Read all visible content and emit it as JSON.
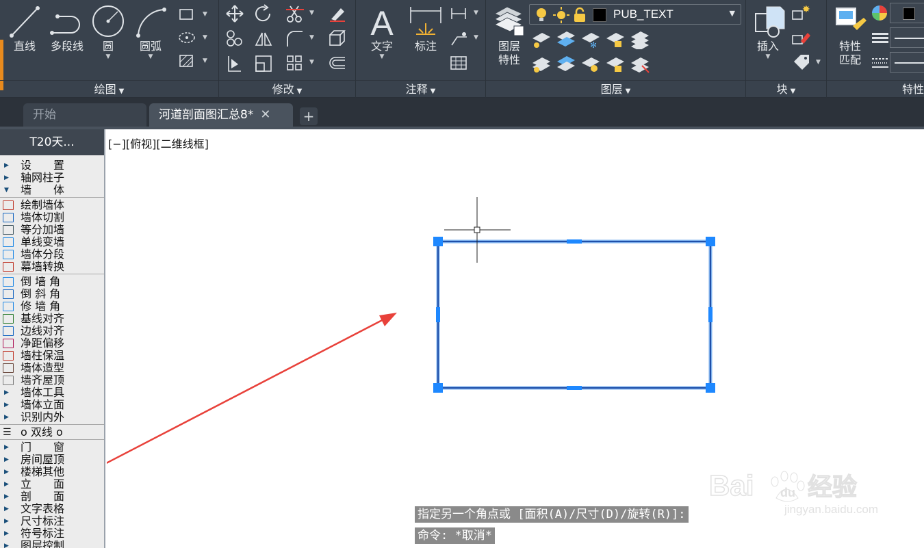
{
  "ribbon": {
    "groups": {
      "draw": {
        "label": "绘图",
        "line": "直线",
        "polyline": "多段线",
        "circle": "圆",
        "arc": "圆弧"
      },
      "modify": {
        "label": "修改"
      },
      "annotation": {
        "label": "注释",
        "text": "文字",
        "dimension": "标注"
      },
      "layers": {
        "label": "图层",
        "layer_properties_line1": "图层",
        "layer_properties_line2": "特性",
        "current_layer": "PUB_TEXT",
        "current_layer_color": "#000000"
      },
      "block": {
        "label": "块",
        "insert": "插入"
      },
      "properties": {
        "label": "特性",
        "match_line1": "特性",
        "match_line2": "匹配"
      }
    },
    "accent_color": "#e88a1d"
  },
  "tabs": {
    "items": [
      {
        "label": "开始"
      },
      {
        "label": "河道剖面图汇总8*",
        "close": "✕"
      }
    ],
    "add": "+"
  },
  "palette": {
    "title": "T20天...",
    "items": [
      "设　　置",
      "轴网柱子",
      "墙　　体",
      "绘制墙体",
      "墙体切割",
      "等分加墙",
      "单线变墙",
      "墙体分段",
      "幕墙转换",
      "倒 墙 角",
      "倒 斜 角",
      "修 墙 角",
      "基线对齐",
      "边线对齐",
      "净距偏移",
      "墙柱保温",
      "墙体造型",
      "墙齐屋顶",
      "墙体工具",
      "墙体立面",
      "识别内外",
      "o 双线 o",
      "门　　窗",
      "房间屋顶",
      "楼梯其他",
      "立　　面",
      "剖　　面",
      "文字表格",
      "尺寸标注",
      "符号标注",
      "图层控制"
    ]
  },
  "canvas": {
    "viewport_label": "[−][俯视][二维线框]",
    "command_prompt": "指定另一个角点或 [面积(A)/尺寸(D)/旋转(R)]:",
    "command_history": "命令: *取消*",
    "selection_color": "#1f6fd6",
    "annotation_arrow_color": "#e8413a"
  },
  "watermark": {
    "text_brand": "Bai",
    "text_du": "du",
    "text_cn": "经验",
    "url": "jingyan.baidu.com"
  }
}
